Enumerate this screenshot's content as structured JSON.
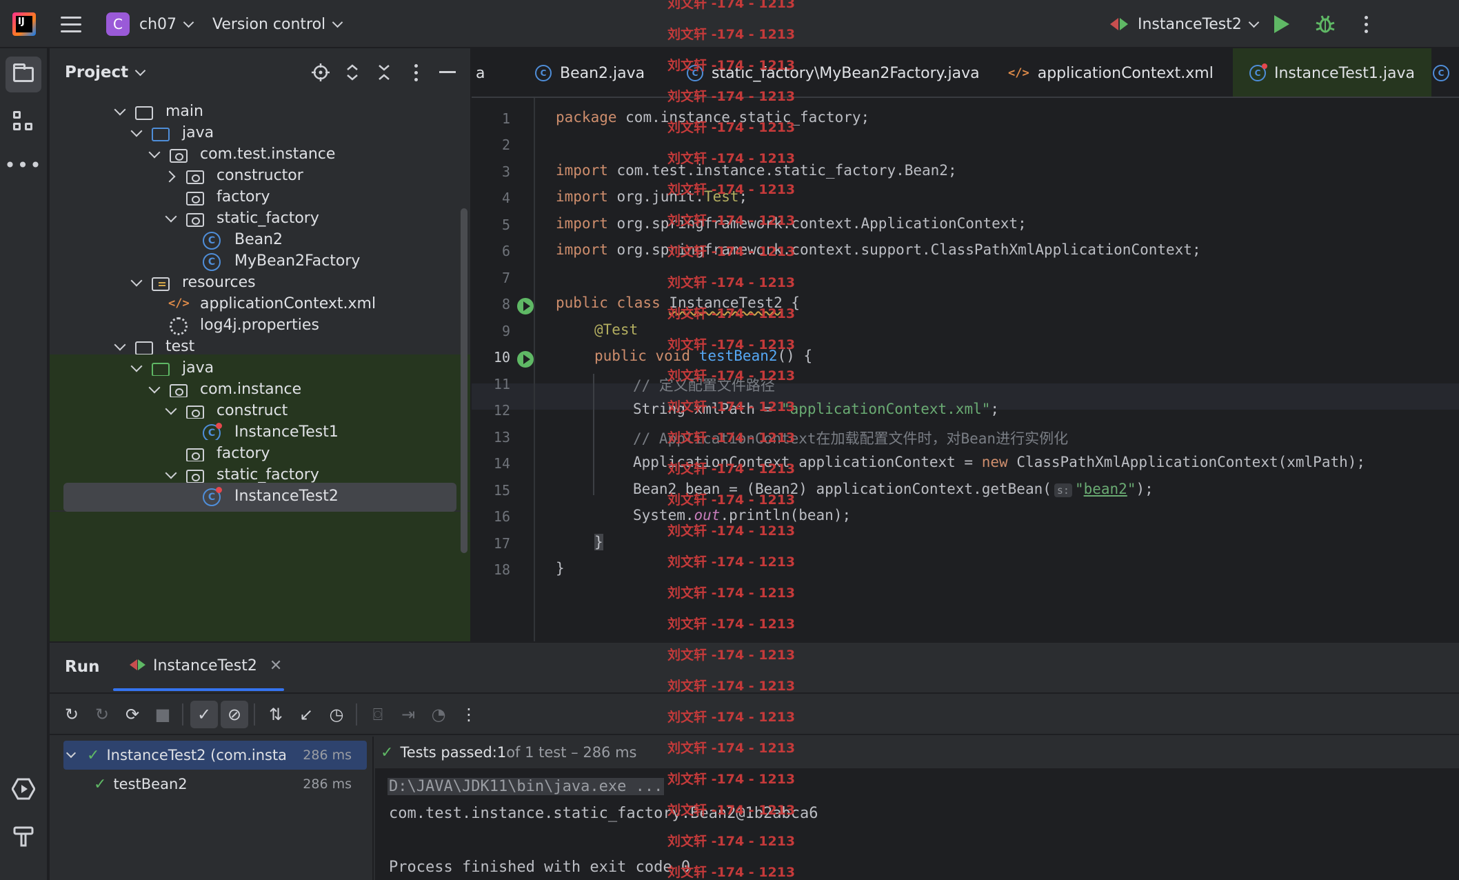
{
  "topbar": {
    "project_badge": "C",
    "project_name": "ch07",
    "vcs_label": "Version control",
    "run_config": "InstanceTest2"
  },
  "project_panel": {
    "title": "Project",
    "tree": [
      {
        "label": "main",
        "kind": "folder"
      },
      {
        "label": "java",
        "kind": "source-folder"
      },
      {
        "label": "com.test.instance",
        "kind": "package"
      },
      {
        "label": "constructor",
        "kind": "package"
      },
      {
        "label": "factory",
        "kind": "package"
      },
      {
        "label": "static_factory",
        "kind": "package"
      },
      {
        "label": "Bean2",
        "kind": "class"
      },
      {
        "label": "MyBean2Factory",
        "kind": "class"
      },
      {
        "label": "resources",
        "kind": "resource-folder"
      },
      {
        "label": "applicationContext.xml",
        "kind": "xml"
      },
      {
        "label": "log4j.properties",
        "kind": "properties"
      },
      {
        "label": "test",
        "kind": "folder"
      },
      {
        "label": "java",
        "kind": "test-folder"
      },
      {
        "label": "com.instance",
        "kind": "package"
      },
      {
        "label": "construct",
        "kind": "package"
      },
      {
        "label": "InstanceTest1",
        "kind": "test-class"
      },
      {
        "label": "factory",
        "kind": "package"
      },
      {
        "label": "static_factory",
        "kind": "package"
      },
      {
        "label": "InstanceTest2",
        "kind": "test-class"
      }
    ]
  },
  "editor": {
    "tabs": [
      {
        "label": "a"
      },
      {
        "label": "Bean2.java"
      },
      {
        "label": "static_factory\\MyBean2Factory.java"
      },
      {
        "label": "applicationContext.xml"
      },
      {
        "label": "InstanceTest1.java"
      }
    ],
    "line_numbers": [
      "1",
      "2",
      "3",
      "4",
      "5",
      "6",
      "7",
      "8",
      "9",
      "10",
      "11",
      "12",
      "13",
      "14",
      "15",
      "16",
      "17",
      "18"
    ],
    "code": {
      "l1_kw": "package",
      "l1_rest": " com.instance.static_factory;",
      "l3_kw": "import",
      "l3_rest": " com.test.instance.static_factory.Bean2;",
      "l4_kw": "import",
      "l4_a": " org.junit.",
      "l4_b": "Test",
      "l4_c": ";",
      "l5_kw": "import",
      "l5_rest": " org.springframework.context.ApplicationContext;",
      "l6_kw": "import",
      "l6_rest": " org.springframework.context.support.ClassPathXmlApplicationContext;",
      "l8_kw": "public class ",
      "l8_name": "InstanceTest2",
      "l8_rest": " {",
      "l9_ann": "@Test",
      "l10_kw": "public void ",
      "l10_fn": "testBean2",
      "l10_rest": "() {",
      "l11_cmt": "// 定义配置文件路径",
      "l12_a": "String xmlPath = ",
      "l12_str": "\"applicationContext.xml\"",
      "l12_b": ";",
      "l13_cmt": "// ApplicationContext在加载配置文件时，对Bean进行实例化",
      "l14_a": "ApplicationContext applicationContext = ",
      "l14_kw": "new",
      "l14_b": " ClassPathXmlApplicationContext(xmlPath);",
      "l15_a": "Bean2 bean = (Bean2) applicationContext.getBean(",
      "l15_hint": "s:",
      "l15_q1": "\"",
      "l15_str": "bean2",
      "l15_q2": "\"",
      "l15_b": ");",
      "l16_a": "System.",
      "l16_out": "out",
      "l16_b": ".println(bean);",
      "l17": "}",
      "l18": "}"
    }
  },
  "watermark": "刘文轩 -174 - 1213",
  "run_panel": {
    "title": "Run",
    "tab_label": "InstanceTest2",
    "tests": [
      {
        "label": "InstanceTest2 (com.instance",
        "duration": "286 ms"
      },
      {
        "label": "testBean2",
        "duration": "286 ms"
      }
    ],
    "summary_passed": "Tests passed: ",
    "summary_count": "1",
    "summary_rest": " of 1 test – 286 ms",
    "console": [
      "D:\\JAVA\\JDK11\\bin\\java.exe ...",
      "com.test.instance.static_factory.Bean2@1b2abca6",
      "",
      "Process finished with exit code 0"
    ]
  }
}
